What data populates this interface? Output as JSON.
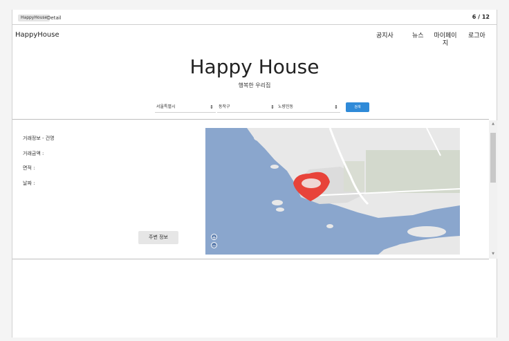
{
  "window": {
    "tab_label": "HappyHouse",
    "tab_detail": "Detail",
    "page_counter": "6 / 12"
  },
  "header": {
    "brand": "HappyHouse",
    "nav": [
      "공지사",
      "뉴스",
      "마이페이\n지",
      "로그아"
    ]
  },
  "hero": {
    "title": "Happy House",
    "subtitle": "행복한 우리집"
  },
  "search": {
    "city": "서울특별시",
    "district": "동작구",
    "dong": "노량진동",
    "button_label": "검색"
  },
  "deal_info": {
    "heading": "거래정보 - 건명",
    "amount_label": "거래금액 :",
    "area_label": "면적 :",
    "date_label": "날짜 :"
  },
  "nearby_button": "주변 정보",
  "map": {
    "water_color": "#8aa6cd",
    "land_color": "#e8e8e8",
    "marker_color": "#e8433a",
    "zoom_in": "+",
    "zoom_out": "−"
  }
}
